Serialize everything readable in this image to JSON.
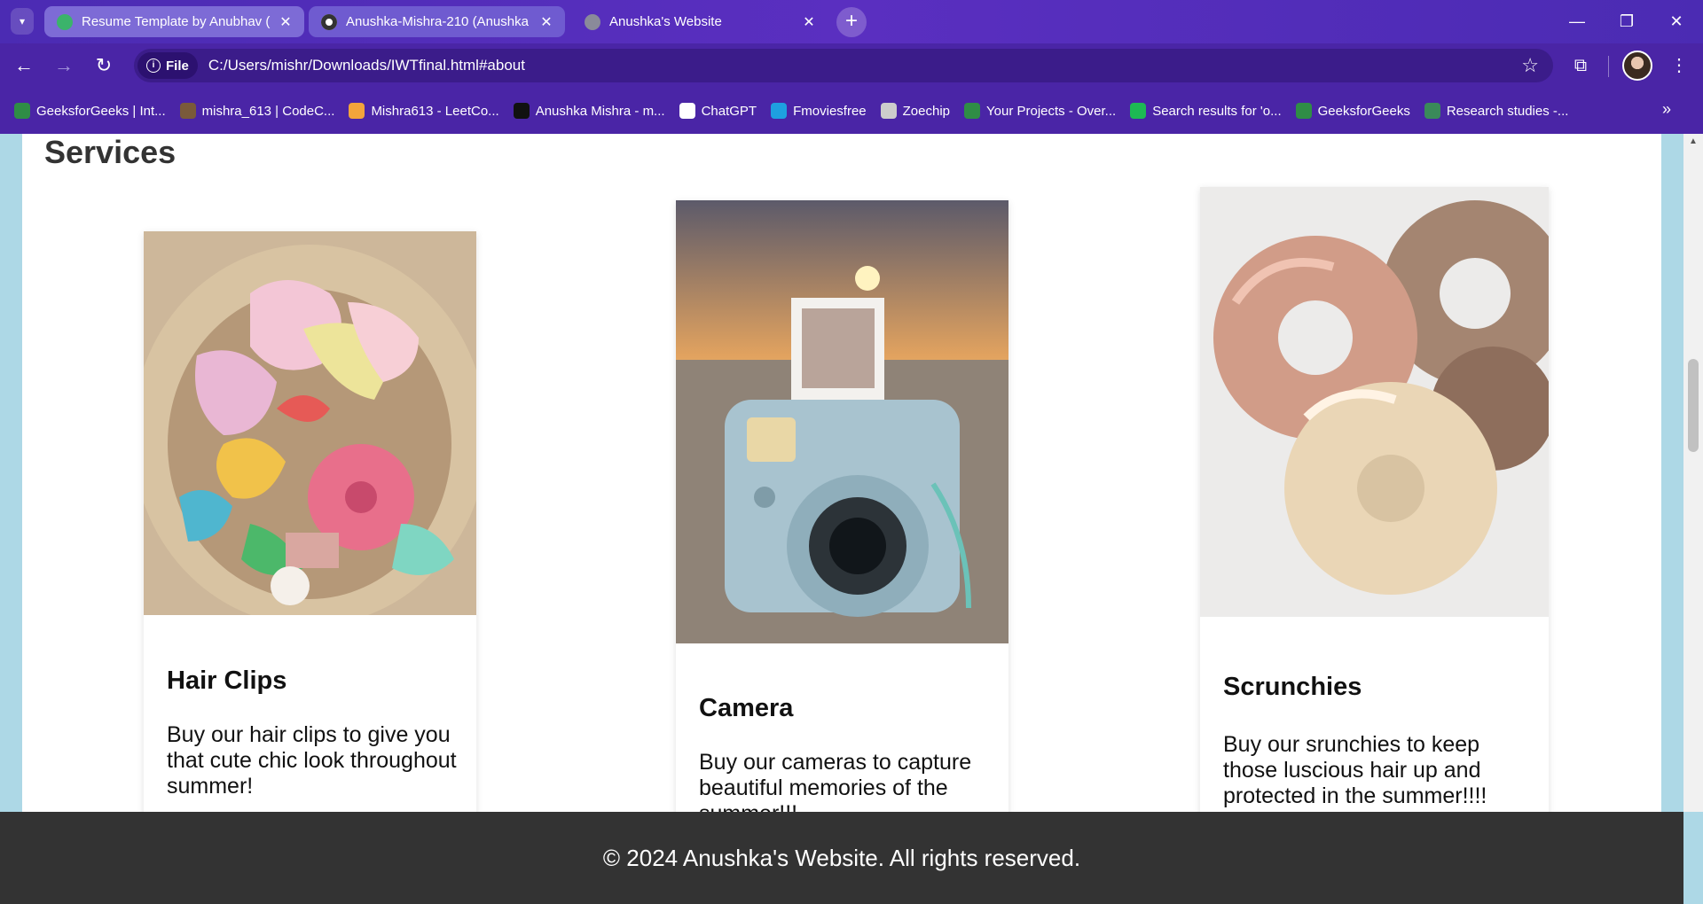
{
  "browser": {
    "tabs": [
      {
        "title": "Resume Template by Anubhav (",
        "active": false
      },
      {
        "title": "Anushka-Mishra-210 (Anushka",
        "active": false
      },
      {
        "title": "Anushka's Website",
        "active": true
      }
    ],
    "address": {
      "chip": "File",
      "url": "C:/Users/mishr/Downloads/IWTfinal.html#about"
    },
    "bookmarks": [
      {
        "label": "GeeksforGeeks | Int...",
        "color": "#2f8d46"
      },
      {
        "label": "mishra_613 | CodeC...",
        "color": "#7a5a3a"
      },
      {
        "label": "Mishra613 - LeetCo...",
        "color": "#f3a43b"
      },
      {
        "label": "Anushka Mishra - m...",
        "color": "#111111"
      },
      {
        "label": "ChatGPT",
        "color": "#ffffff"
      },
      {
        "label": "Fmoviesfree",
        "color": "#1ea0e0"
      },
      {
        "label": "Zoechip",
        "color": "#cccccc"
      },
      {
        "label": "Your Projects - Over...",
        "color": "#2f8d46"
      },
      {
        "label": "Search results for 'o...",
        "color": "#1db954"
      },
      {
        "label": "GeeksforGeeks",
        "color": "#2f8d46"
      },
      {
        "label": "Research studies -...",
        "color": "#3a8a5a"
      }
    ]
  },
  "page": {
    "section_title": "Services",
    "services": [
      {
        "title": "Hair Clips",
        "description": "Buy our hair clips to give you that cute chic look throughout summer!"
      },
      {
        "title": "Camera",
        "description": "Buy our cameras to capture beautiful memories of the summer!!!"
      },
      {
        "title": "Scrunchies",
        "description": "Buy our srunchies to keep those luscious hair up and protected in the summer!!!!"
      }
    ],
    "footer": "© 2024 Anushka's Website. All rights reserved."
  },
  "colors": {
    "accent": "#4a25a6",
    "page_bg": "#add8e6",
    "footer_bg": "#333333"
  }
}
